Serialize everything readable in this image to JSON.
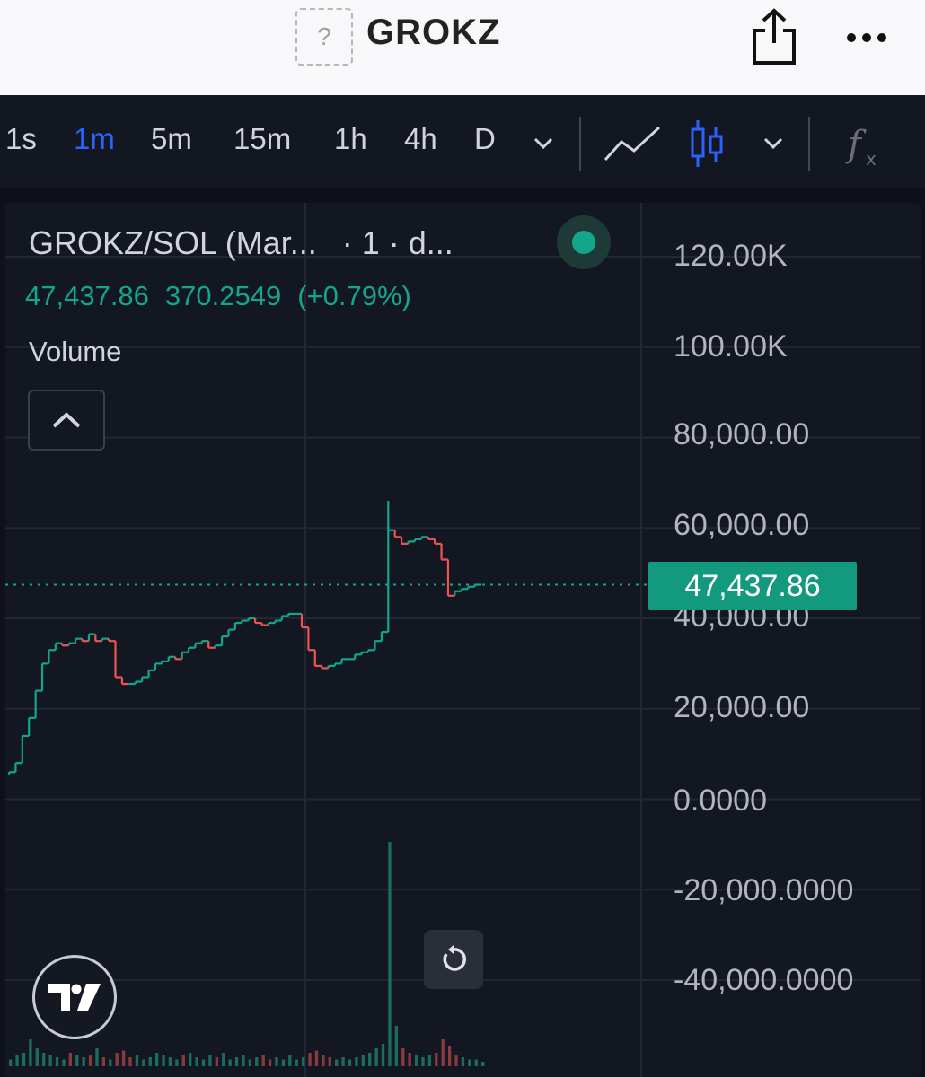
{
  "header": {
    "token_icon_glyph": "?",
    "title": "GROKZ",
    "share_icon": "share-icon",
    "more_icon": "more-horizontal-icon"
  },
  "toolbar": {
    "intervals": [
      "1s",
      "1m",
      "5m",
      "15m",
      "1h",
      "4h",
      "D"
    ],
    "active_interval": "1m",
    "icons": [
      "chevron-down-icon",
      "line-chart-icon",
      "candlestick-icon",
      "chevron-down-icon",
      "indicator-fx-icon"
    ]
  },
  "legend": {
    "symbol": "GROKZ/SOL (Mar...",
    "timeframe": "· 1 · d...",
    "close": "47,437.86",
    "change": "370.2549",
    "change_pct": "(+0.79%)",
    "volume_label": "Volume"
  },
  "colors": {
    "up": "#13a688",
    "down": "#ef5350",
    "accent": "#2962ff",
    "background": "#0e111a"
  },
  "chart_data": {
    "type": "line",
    "style": "candlestick-step",
    "ylim": [
      -40000,
      120000
    ],
    "y_tick_labels": [
      "120.00K",
      "100.00K",
      "80,000.00",
      "60,000.00",
      "40,000.00",
      "20,000.00",
      "0.0000",
      "-20,000.0000",
      "-40,000.0000"
    ],
    "current_price": 47437.86,
    "current_price_label": "47,437.86",
    "series": [
      {
        "values": [
          5500,
          6000,
          8000,
          14000,
          18000,
          24000,
          30000,
          33000,
          34500,
          34000,
          34500,
          35500,
          35000,
          36500,
          35000,
          35500,
          35000,
          27000,
          25500,
          25500,
          26000,
          27000,
          28500,
          30000,
          30500,
          31500,
          31000,
          32500,
          33500,
          34500,
          35000,
          33500,
          34000,
          36000,
          37500,
          39000,
          39500,
          40000,
          39000,
          38500,
          39000,
          39500,
          40500,
          41000,
          41000,
          38000,
          33000,
          29500,
          29000,
          29500,
          30000,
          31000,
          31000,
          32000,
          32500,
          33000,
          35000,
          37000,
          59500,
          58000,
          56500,
          57000,
          57500,
          58000,
          57500,
          56500,
          53000,
          45000,
          46000,
          46500,
          47000,
          47437.86
        ]
      }
    ],
    "volume": [
      3,
      5,
      6,
      12,
      8,
      6,
      5,
      4,
      3,
      6,
      5,
      4,
      5,
      8,
      4,
      3,
      6,
      7,
      4,
      5,
      3,
      4,
      6,
      5,
      4,
      3,
      5,
      6,
      4,
      3,
      5,
      4,
      6,
      3,
      4,
      5,
      3,
      4,
      5,
      3,
      4,
      3,
      5,
      3,
      4,
      6,
      7,
      5,
      4,
      3,
      4,
      3,
      4,
      5,
      6,
      8,
      10,
      100,
      18,
      8,
      6,
      5,
      4,
      5,
      6,
      12,
      9,
      5,
      4,
      3,
      3,
      2
    ]
  }
}
